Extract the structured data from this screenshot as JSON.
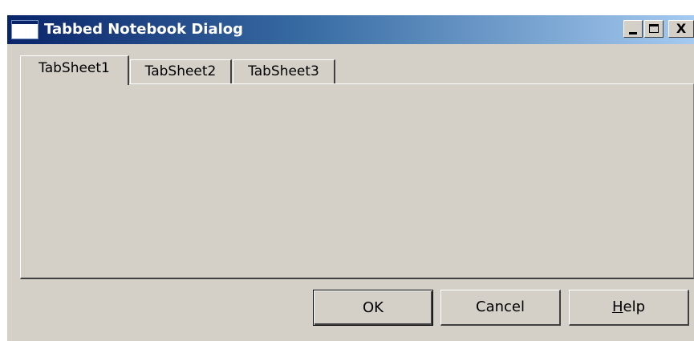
{
  "window": {
    "title": "Tabbed Notebook Dialog",
    "icon": "window-app-icon",
    "accent_color": "#0a246a"
  },
  "caption_buttons": {
    "minimize_icon": "minimize-icon",
    "maximize_icon": "maximize-icon",
    "close_glyph": "X"
  },
  "tabs": [
    {
      "label": "TabSheet1",
      "active": true
    },
    {
      "label": "TabSheet2",
      "active": false
    },
    {
      "label": "TabSheet3",
      "active": false
    }
  ],
  "buttons": {
    "ok_label": "OK",
    "cancel_label": "Cancel",
    "help_accel": "H",
    "help_rest": "elp"
  }
}
